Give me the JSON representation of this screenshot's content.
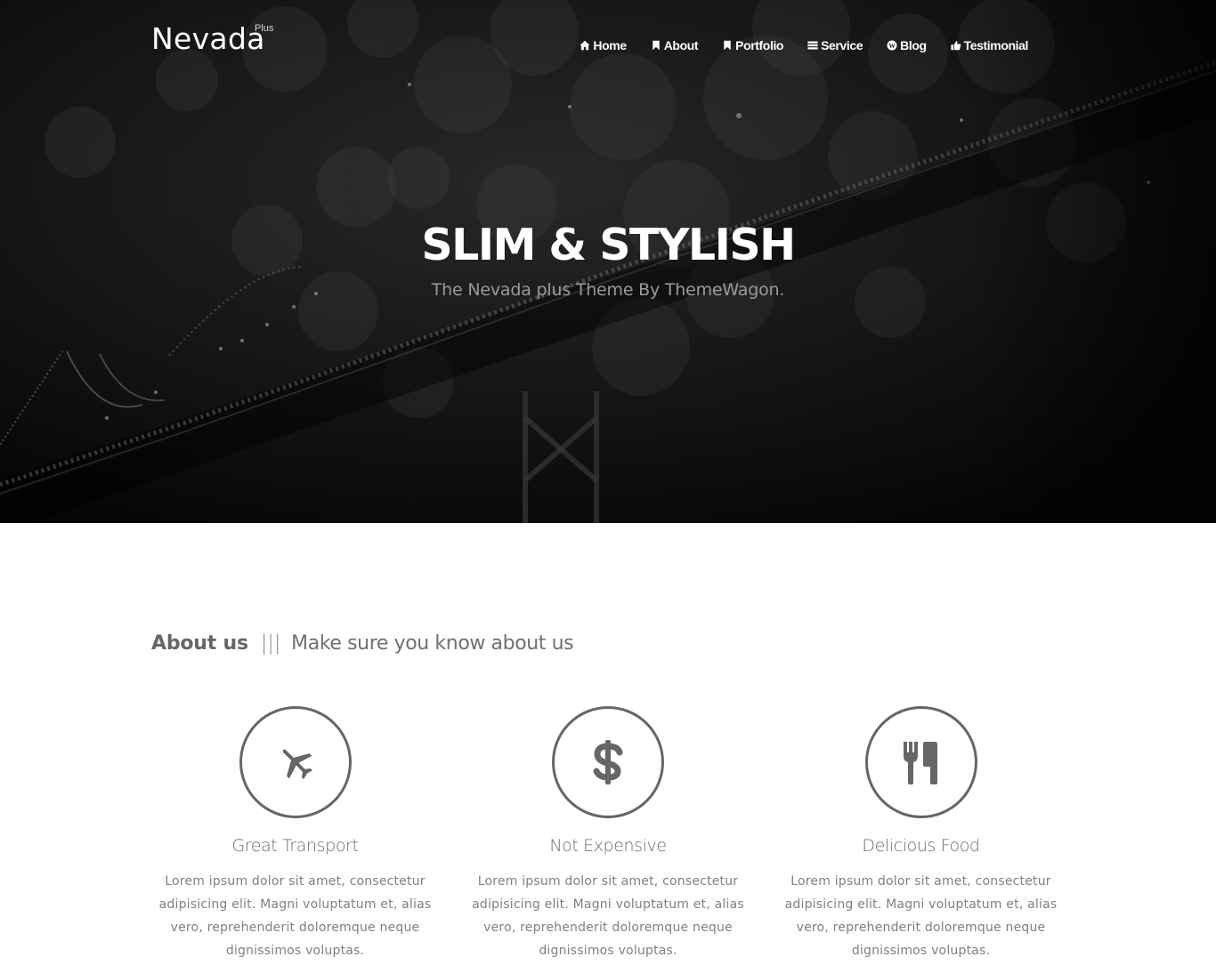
{
  "brand": {
    "name": "Nevada",
    "superscript": "Plus"
  },
  "nav": {
    "items": [
      {
        "label": "Home",
        "icon": "home-icon"
      },
      {
        "label": "About",
        "icon": "bookmark-icon"
      },
      {
        "label": "Portfolio",
        "icon": "bookmark-icon"
      },
      {
        "label": "Service",
        "icon": "tasks-icon"
      },
      {
        "label": "Blog",
        "icon": "wordpress-icon"
      },
      {
        "label": "Testimonial",
        "icon": "thumbs-up-icon"
      }
    ]
  },
  "hero": {
    "title": "SLIM & STYLISH",
    "subtitle": "The Nevada plus Theme By ThemeWagon."
  },
  "about": {
    "heading": "About us",
    "separator": "|||",
    "subheading": "Make sure you know about us",
    "features": [
      {
        "icon": "plane-icon",
        "title": "Great Transport",
        "text": "Lorem ipsum dolor sit amet, consectetur adipisicing elit. Magni voluptatum et, alias vero, reprehenderit doloremque neque dignissimos voluptas."
      },
      {
        "icon": "dollar-icon",
        "title": "Not Expensive",
        "text": "Lorem ipsum dolor sit amet, consectetur adipisicing elit. Magni voluptatum et, alias vero, reprehenderit doloremque neque dignissimos voluptas."
      },
      {
        "icon": "cutlery-icon",
        "title": "Delicious Food",
        "text": "Lorem ipsum dolor sit amet, consectetur adipisicing elit. Magni voluptatum et, alias vero, reprehenderit doloremque neque dignissimos voluptas."
      }
    ]
  },
  "colors": {
    "hero_bg": "#0c0c0c",
    "icon_gray": "#666666",
    "text_gray": "#808080"
  }
}
